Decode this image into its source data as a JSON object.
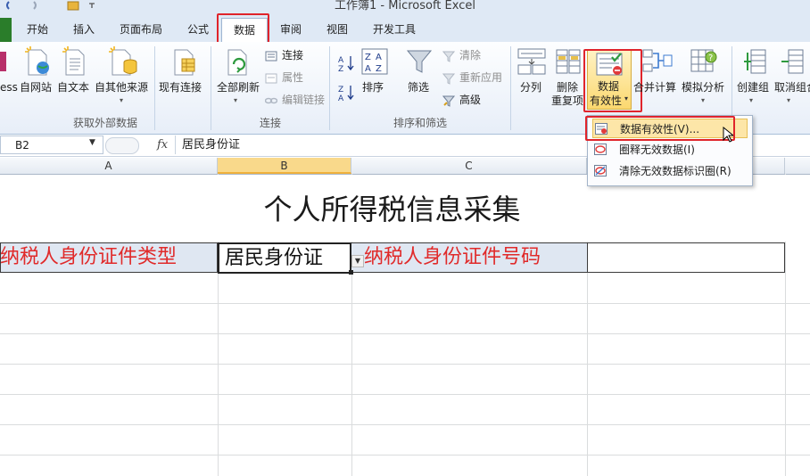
{
  "window": {
    "title": "工作簿1 - Microsoft Excel"
  },
  "tabs": [
    {
      "label": "开始"
    },
    {
      "label": "插入"
    },
    {
      "label": "页面布局"
    },
    {
      "label": "公式"
    },
    {
      "label": "数据"
    },
    {
      "label": "审阅"
    },
    {
      "label": "视图"
    },
    {
      "label": "开发工具"
    }
  ],
  "ribbon": {
    "get_external": {
      "group_label": "获取外部数据",
      "access": "ess",
      "web": "自网站",
      "text": "自文本",
      "other": "自其他来源",
      "existing": "现有连接"
    },
    "connections": {
      "group_label": "连接",
      "refresh_all": "全部刷新",
      "connections": "连接",
      "properties": "属性",
      "edit_links": "编辑链接"
    },
    "sort_filter": {
      "group_label": "排序和筛选",
      "sort": "排序",
      "filter": "筛选",
      "clear": "清除",
      "reapply": "重新应用",
      "advanced": "高级"
    },
    "data_tools": {
      "split": "分列",
      "remove_dup_1": "删除",
      "remove_dup_2": "重复项",
      "validation_1": "数据",
      "validation_2": "有效性",
      "consolidate": "合并计算",
      "whatif": "模拟分析"
    },
    "outline": {
      "group": "创建组",
      "ungroup": "取消组合"
    }
  },
  "validation_menu": {
    "items": [
      {
        "label": "数据有效性(V)..."
      },
      {
        "label": "圈释无效数据(I)"
      },
      {
        "label": "清除无效数据标识圈(R)"
      }
    ]
  },
  "formula_bar": {
    "name_box": "B2",
    "fx": "fx",
    "formula": "居民身份证"
  },
  "sheet": {
    "columns": [
      "A",
      "B",
      "C"
    ],
    "title": "个人所得税信息采集",
    "a2": "纳税人身份证件类型",
    "b2": "居民身份证",
    "c2": "纳税人身份证件号码"
  },
  "colors": {
    "accent_red": "#e0242b",
    "cell_red_text": "#e02a2a",
    "selected_col": "#f9d98b"
  }
}
